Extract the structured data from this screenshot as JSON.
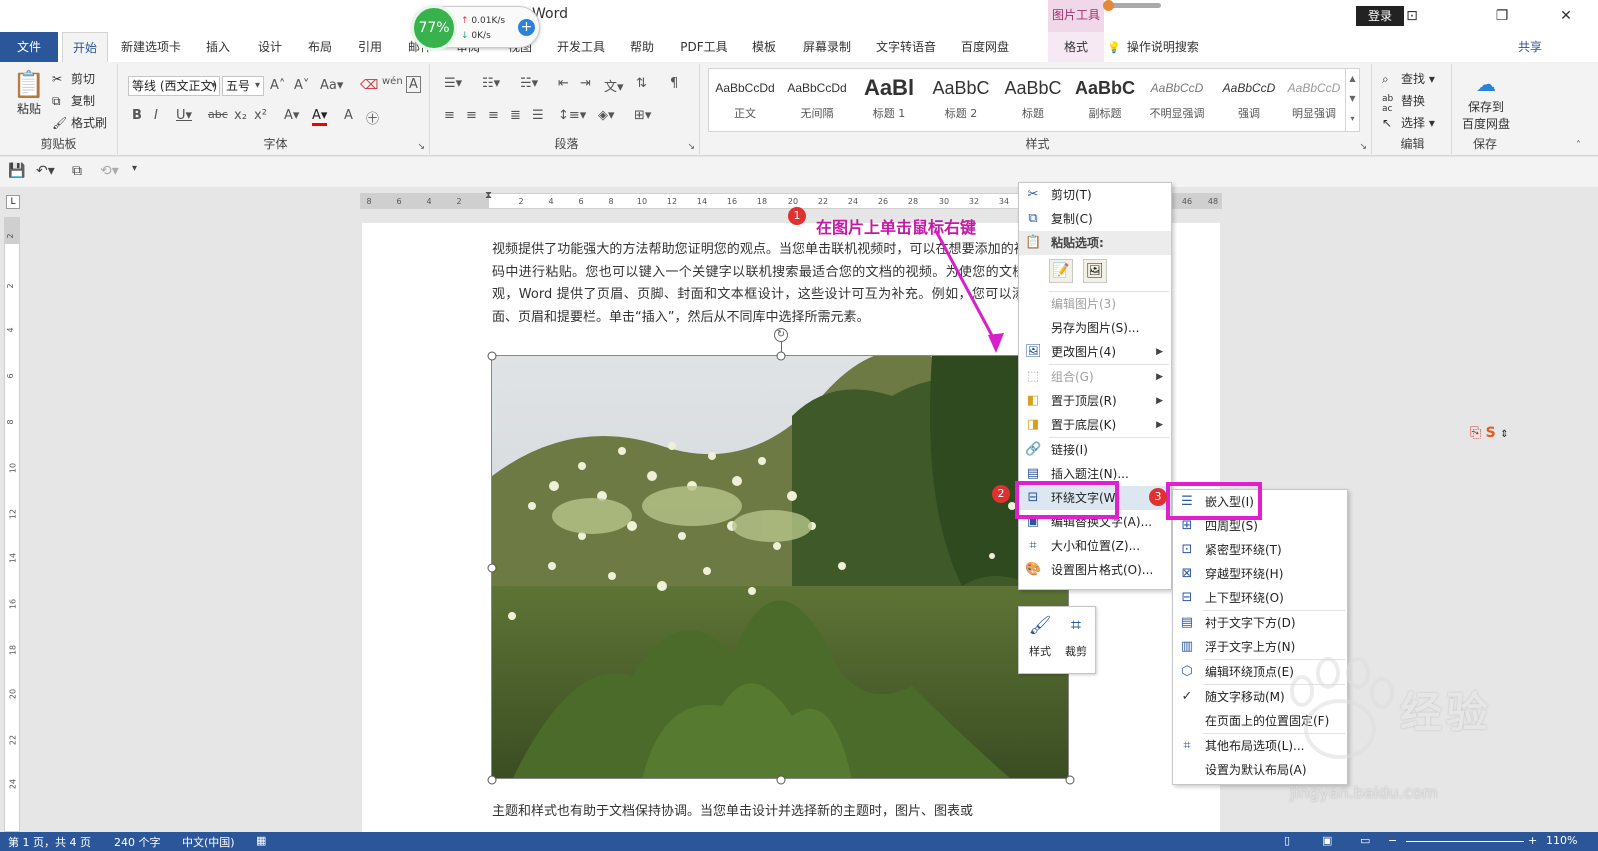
{
  "titlebar": {
    "title": "Word",
    "context_group": "图片工具",
    "login": "登录"
  },
  "net_widget": {
    "percent": "77%",
    "up": "0.01K/s",
    "down": "0K/s"
  },
  "tabs": [
    "文件",
    "开始",
    "新建选项卡",
    "插入",
    "设计",
    "布局",
    "引用",
    "邮件",
    "审阅",
    "视图",
    "开发工具",
    "帮助",
    "PDF工具",
    "模板",
    "屏幕录制",
    "文字转语音",
    "百度网盘",
    "格式",
    "操作说明搜索",
    "共享"
  ],
  "ribbon": {
    "clipboard": {
      "paste": "粘贴",
      "cut": "剪切",
      "copy": "复制",
      "format_painter": "格式刷",
      "label": "剪贴板"
    },
    "font": {
      "font_name": "等线 (西文正文)",
      "font_size": "五号",
      "label": "字体"
    },
    "paragraph": {
      "label": "段落"
    },
    "styles": {
      "label": "样式",
      "items": [
        {
          "sample": "AaBbCcDd",
          "name": "正文"
        },
        {
          "sample": "AaBbCcDd",
          "name": "无间隔"
        },
        {
          "sample": "AaBl",
          "name": "标题 1"
        },
        {
          "sample": "AaBbC",
          "name": "标题 2"
        },
        {
          "sample": "AaBbC",
          "name": "标题"
        },
        {
          "sample": "AaBbC",
          "name": "副标题"
        },
        {
          "sample": "AaBbCcD",
          "name": "不明显强调"
        },
        {
          "sample": "AaBbCcD",
          "name": "强调"
        },
        {
          "sample": "AaBbCcD",
          "name": "明显强调"
        }
      ]
    },
    "editing": {
      "find": "查找",
      "replace": "替换",
      "select": "选择",
      "label": "编辑"
    },
    "save": {
      "save_to": "保存到",
      "baidu": "百度网盘",
      "label": "保存"
    }
  },
  "ruler": {
    "h_ticks": [
      "8",
      "6",
      "4",
      "2",
      "2",
      "4",
      "6",
      "8",
      "10",
      "12",
      "14",
      "16",
      "18",
      "20",
      "22",
      "24",
      "26",
      "28",
      "30",
      "32",
      "34",
      "36",
      "38",
      "40",
      "42",
      "44",
      "46",
      "48"
    ],
    "v_ticks": [
      "2",
      "2",
      "4",
      "6",
      "8",
      "10",
      "12",
      "14",
      "16",
      "18",
      "20",
      "22",
      "24"
    ]
  },
  "document": {
    "paragraph1": "视频提供了功能强大的方法帮助您证明您的观点。当您单击联机视频时，可以在想要添加的视频的嵌入代码中进行粘贴。您也可以键入一个关键字以联机搜索最适合您的文档的视频。为使您的文档具有专业外观，Word 提供了页眉、页脚、封面和文本框设计，这些设计可互为补充。例如，您可以添加匹配的封面、页眉和提要栏。单击“插入”，然后从不同库中选择所需元素。",
    "paragraph2": "主题和样式也有助于文档保持协调。当您单击设计并选择新的主题时，图片、图表或"
  },
  "annotations": {
    "step1_num": "1",
    "step1_text": "在图片上单击鼠标右键",
    "step2_num": "2",
    "step3_num": "3"
  },
  "context_menu": {
    "cut": "剪切(T)",
    "copy": "复制(C)",
    "paste_options": "粘贴选项:",
    "edit_picture": "编辑图片(3)",
    "save_as_picture": "另存为图片(S)...",
    "change_picture": "更改图片(4)",
    "group": "组合(G)",
    "bring_front": "置于顶层(R)",
    "send_back": "置于底层(K)",
    "link": "链接(I)",
    "insert_caption": "插入题注(N)...",
    "wrap_text": "环绕文字(W)",
    "edit_alt_text": "编辑替换文字(A)...",
    "size_position": "大小和位置(Z)...",
    "format_picture": "设置图片格式(O)..."
  },
  "mini_toolbar": {
    "style": "样式",
    "crop": "裁剪"
  },
  "wrap_submenu": {
    "inline": "嵌入型(I)",
    "square": "四周型(S)",
    "tight": "紧密型环绕(T)",
    "through": "穿越型环绕(H)",
    "top_bottom": "上下型环绕(O)",
    "behind": "衬于文字下方(D)",
    "in_front": "浮于文字上方(N)",
    "edit_points": "编辑环绕顶点(E)",
    "move_with_text": "随文字移动(M)",
    "fix_position": "在页面上的位置固定(F)",
    "more_layout": "其他布局选项(L)...",
    "set_default": "设置为默认布局(A)"
  },
  "statusbar": {
    "page": "第 1 页，共 4 页",
    "words": "240 个字",
    "lang": "中文(中国)",
    "zoom": "110%"
  },
  "watermark": {
    "brand": "经验",
    "url": "jingyan.baidu.com"
  },
  "colors": {
    "accent": "#2b579a",
    "highlight": "#e020d0",
    "badge": "#e03131",
    "callout": "#c41aa6"
  }
}
